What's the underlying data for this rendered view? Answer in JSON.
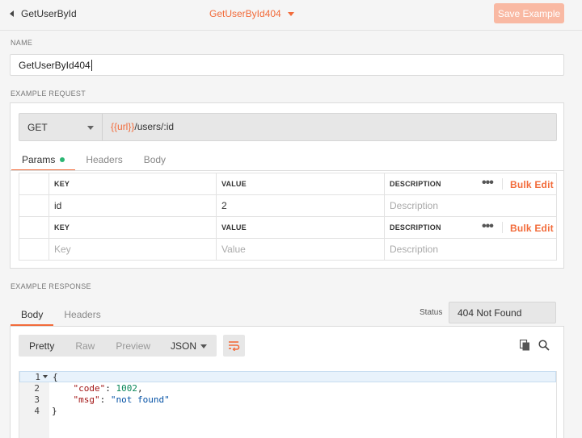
{
  "header": {
    "back_label": "GetUserById",
    "example_title": "GetUserById404",
    "save_label": "Save Example"
  },
  "name_section": {
    "label": "NAME",
    "value": "GetUserById404"
  },
  "request": {
    "section_label": "EXAMPLE REQUEST",
    "method": "GET",
    "url_var": "{{url}}",
    "url_path": "/users/:id",
    "tabs": [
      {
        "label": "Params",
        "active": true,
        "has_dot": true
      },
      {
        "label": "Headers",
        "active": false
      },
      {
        "label": "Body",
        "active": false
      }
    ],
    "path_params": {
      "headers": {
        "key": "KEY",
        "value": "VALUE",
        "description": "DESCRIPTION"
      },
      "rows": [
        {
          "key": "id",
          "value": "2",
          "description": "Description"
        }
      ]
    },
    "query_params": {
      "headers": {
        "key": "KEY",
        "value": "VALUE",
        "description": "DESCRIPTION"
      },
      "placeholders": {
        "key": "Key",
        "value": "Value",
        "description": "Description"
      }
    },
    "bulk_edit_label": "Bulk Edit",
    "more_glyph": "•••"
  },
  "response": {
    "section_label": "EXAMPLE RESPONSE",
    "tabs": [
      {
        "label": "Body",
        "active": true
      },
      {
        "label": "Headers",
        "active": false
      }
    ],
    "status_label": "Status",
    "status_value": "404 Not Found",
    "format_buttons": [
      {
        "label": "Pretty",
        "active": true
      },
      {
        "label": "Raw",
        "active": false
      },
      {
        "label": "Preview",
        "active": false
      }
    ],
    "language": "JSON",
    "code_lines": [
      {
        "num": "1",
        "text": "{"
      },
      {
        "num": "2",
        "key": "\"code\"",
        "sep": ": ",
        "val": "1002",
        "trail": ","
      },
      {
        "num": "3",
        "key": "\"msg\"",
        "sep": ": ",
        "val": "\"not found\"",
        "trail": ""
      },
      {
        "num": "4",
        "text": "}"
      }
    ]
  },
  "colors": {
    "accent": "#f26b3a",
    "save_disabled": "#f9b9a3",
    "params_dot": "#2bb673"
  }
}
